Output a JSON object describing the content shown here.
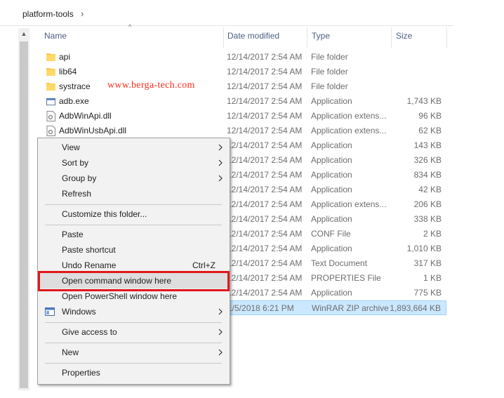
{
  "breadcrumb": {
    "path": "platform-tools",
    "chevron": "›"
  },
  "columns": {
    "name": "Name",
    "date": "Date modified",
    "type": "Type",
    "size": "Size"
  },
  "sort_indicator": "^",
  "watermark": "www.berga-tech.com",
  "files": [
    {
      "name": "api",
      "date": "12/14/2017 2:54 AM",
      "type": "File folder",
      "size": "",
      "icon": "folder-icon"
    },
    {
      "name": "lib64",
      "date": "12/14/2017 2:54 AM",
      "type": "File folder",
      "size": "",
      "icon": "folder-icon"
    },
    {
      "name": "systrace",
      "date": "12/14/2017 2:54 AM",
      "type": "File folder",
      "size": "",
      "icon": "folder-icon"
    },
    {
      "name": "adb.exe",
      "date": "12/14/2017 2:54 AM",
      "type": "Application",
      "size": "1,743 KB",
      "icon": "exe-icon"
    },
    {
      "name": "AdbWinApi.dll",
      "date": "12/14/2017 2:54 AM",
      "type": "Application extens...",
      "size": "96 KB",
      "icon": "dll-icon"
    },
    {
      "name": "AdbWinUsbApi.dll",
      "date": "12/14/2017 2:54 AM",
      "type": "Application extens...",
      "size": "62 KB",
      "icon": "dll-icon"
    },
    {
      "name": "",
      "date": "12/14/2017 2:54 AM",
      "type": "Application",
      "size": "143 KB",
      "icon": ""
    },
    {
      "name": "",
      "date": "12/14/2017 2:54 AM",
      "type": "Application",
      "size": "326 KB",
      "icon": ""
    },
    {
      "name": "",
      "date": "12/14/2017 2:54 AM",
      "type": "Application",
      "size": "834 KB",
      "icon": ""
    },
    {
      "name": "",
      "date": "12/14/2017 2:54 AM",
      "type": "Application",
      "size": "42 KB",
      "icon": ""
    },
    {
      "name": "",
      "date": "12/14/2017 2:54 AM",
      "type": "Application extens...",
      "size": "206 KB",
      "icon": ""
    },
    {
      "name": "",
      "date": "12/14/2017 2:54 AM",
      "type": "Application",
      "size": "338 KB",
      "icon": ""
    },
    {
      "name": "",
      "date": "12/14/2017 2:54 AM",
      "type": "CONF File",
      "size": "2 KB",
      "icon": ""
    },
    {
      "name": "",
      "date": "12/14/2017 2:54 AM",
      "type": "Application",
      "size": "1,010 KB",
      "icon": ""
    },
    {
      "name": "",
      "date": "12/14/2017 2:54 AM",
      "type": "Text Document",
      "size": "317 KB",
      "icon": ""
    },
    {
      "name": "",
      "date": "12/14/2017 2:54 AM",
      "type": "PROPERTIES File",
      "size": "1 KB",
      "icon": ""
    },
    {
      "name": "",
      "date": "12/14/2017 2:54 AM",
      "type": "Application",
      "size": "775 KB",
      "icon": ""
    },
    {
      "name": "",
      "date": "1/5/2018 6:21 PM",
      "type": "WinRAR ZIP archive",
      "size": "1,893,664 KB",
      "icon": "",
      "selected": true
    }
  ],
  "context_menu": {
    "view": "View",
    "sort_by": "Sort by",
    "group_by": "Group by",
    "refresh": "Refresh",
    "customize": "Customize this folder...",
    "paste": "Paste",
    "paste_shortcut": "Paste shortcut",
    "undo_rename": "Undo Rename",
    "undo_shortcut": "Ctrl+Z",
    "open_cmd": "Open command window here",
    "open_powershell": "Open PowerShell window here",
    "windows": "Windows",
    "give_access": "Give access to",
    "new": "New",
    "properties": "Properties"
  },
  "colors": {
    "highlight_border": "#e2171e",
    "watermark": "#ff2a1a",
    "selection": "#cce8ff"
  }
}
